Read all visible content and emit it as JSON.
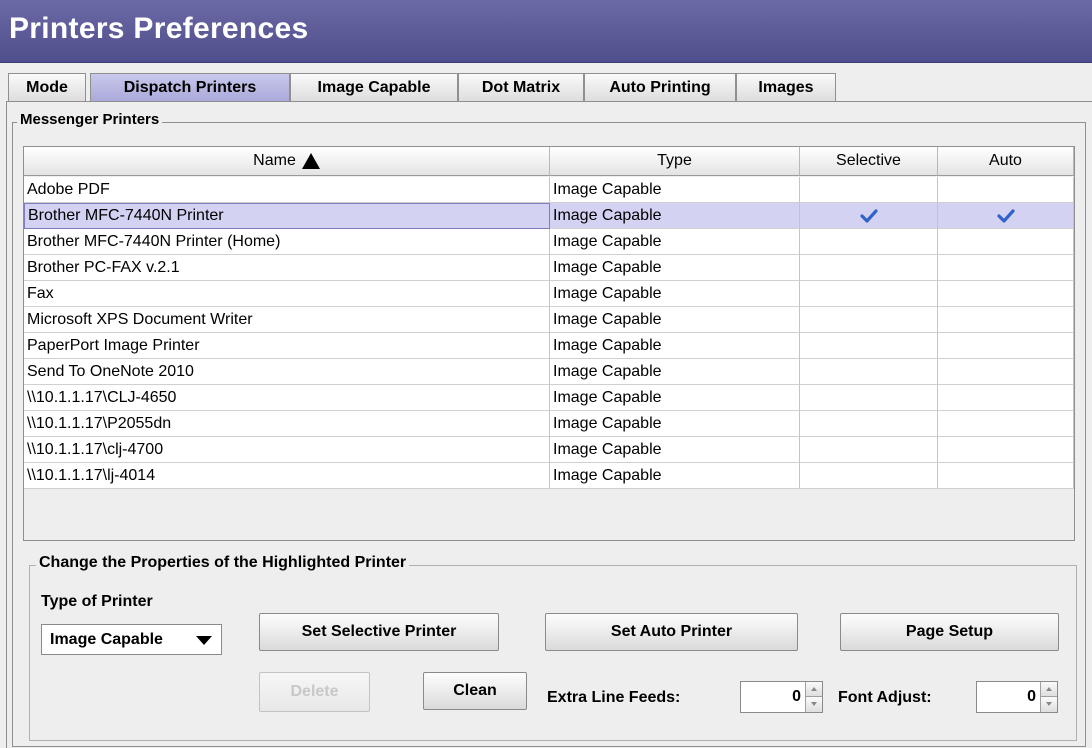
{
  "window": {
    "title": "Printers Preferences"
  },
  "tabs": [
    {
      "label": "Mode",
      "active": false
    },
    {
      "label": "Dispatch Printers",
      "active": true
    },
    {
      "label": "Image Capable",
      "active": false
    },
    {
      "label": "Dot Matrix",
      "active": false
    },
    {
      "label": "Auto Printing",
      "active": false
    },
    {
      "label": "Images",
      "active": false
    }
  ],
  "messenger_group": {
    "label": "Messenger Printers"
  },
  "table": {
    "columns": [
      "Name",
      "Type",
      "Selective",
      "Auto"
    ],
    "sort_column": "Name",
    "sort_direction": "ascending",
    "selected_row": 1,
    "rows": [
      {
        "name": "Adobe PDF",
        "type": "Image Capable",
        "selective": false,
        "auto": false
      },
      {
        "name": "Brother MFC-7440N Printer",
        "type": "Image Capable",
        "selective": true,
        "auto": true
      },
      {
        "name": "Brother MFC-7440N Printer (Home)",
        "type": "Image Capable",
        "selective": false,
        "auto": false
      },
      {
        "name": "Brother PC-FAX v.2.1",
        "type": "Image Capable",
        "selective": false,
        "auto": false
      },
      {
        "name": "Fax",
        "type": "Image Capable",
        "selective": false,
        "auto": false
      },
      {
        "name": "Microsoft XPS Document Writer",
        "type": "Image Capable",
        "selective": false,
        "auto": false
      },
      {
        "name": "PaperPort Image Printer",
        "type": "Image Capable",
        "selective": false,
        "auto": false
      },
      {
        "name": "Send To OneNote 2010",
        "type": "Image Capable",
        "selective": false,
        "auto": false
      },
      {
        "name": "\\\\10.1.1.17\\CLJ-4650",
        "type": "Image Capable",
        "selective": false,
        "auto": false
      },
      {
        "name": "\\\\10.1.1.17\\P2055dn",
        "type": "Image Capable",
        "selective": false,
        "auto": false
      },
      {
        "name": "\\\\10.1.1.17\\clj-4700",
        "type": "Image Capable",
        "selective": false,
        "auto": false
      },
      {
        "name": "\\\\10.1.1.17\\lj-4014",
        "type": "Image Capable",
        "selective": false,
        "auto": false
      }
    ]
  },
  "properties": {
    "group_label": "Change the Properties of the Highlighted Printer",
    "type_label": "Type of Printer",
    "type_value": "Image Capable",
    "set_selective_label": "Set Selective Printer",
    "set_auto_label": "Set Auto Printer",
    "page_setup_label": "Page Setup",
    "delete_label": "Delete",
    "clean_label": "Clean",
    "extra_line_feeds_label": "Extra Line Feeds:",
    "extra_line_feeds_value": "0",
    "font_adjust_label": "Font Adjust:",
    "font_adjust_value": "0"
  },
  "colors": {
    "titlebar": "#5c5b99",
    "active_tab": "#b8b7e3",
    "selected_row": "#d3d2f3",
    "checkmark": "#2f63c8"
  }
}
